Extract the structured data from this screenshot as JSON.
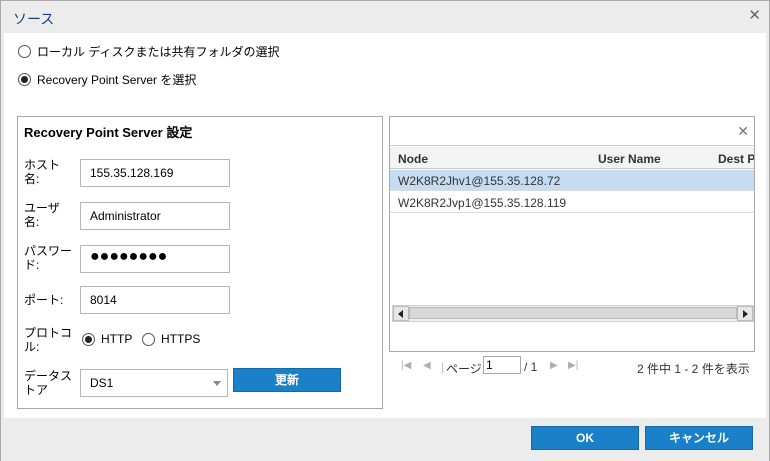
{
  "dialog": {
    "title": "ソース"
  },
  "source_options": [
    {
      "label": "ローカル ディスクまたは共有フォルダの選択",
      "checked": false
    },
    {
      "label": "Recovery Point Server を選択",
      "checked": true
    }
  ],
  "rps_settings": {
    "section_title": "Recovery Point Server 設定",
    "hostname_label": "ホスト名:",
    "hostname_value": "155.35.128.169",
    "username_label": "ユーザ名:",
    "username_value": "Administrator",
    "password_label": "パスワード:",
    "password_value": "●●●●●●●●",
    "port_label": "ポート:",
    "port_value": "8014",
    "protocol_label": "プロトコル:",
    "protocols": [
      {
        "label": "HTTP",
        "checked": true
      },
      {
        "label": "HTTPS",
        "checked": false
      }
    ],
    "datastore_label": "データストア",
    "datastore_value": "DS1",
    "refresh_button": "更新"
  },
  "node_grid": {
    "columns": [
      "Node",
      "User Name",
      "Dest P"
    ],
    "rows": [
      {
        "node": "W2K8R2Jhv1@155.35.128.72",
        "selected": true
      },
      {
        "node": "W2K8R2Jvp1@155.35.128.119",
        "selected": false
      }
    ]
  },
  "pager": {
    "page_label": "ページ",
    "page_value": "1",
    "total_pages": "/ 1",
    "summary": "2 件中 1 - 2 件を表示"
  },
  "footer": {
    "ok_button": "OK",
    "cancel_button": "キャンセル"
  },
  "colors": {
    "accent": "#1a80c8",
    "selected_row": "#c5dcf3",
    "title": "#1a3f8a"
  }
}
